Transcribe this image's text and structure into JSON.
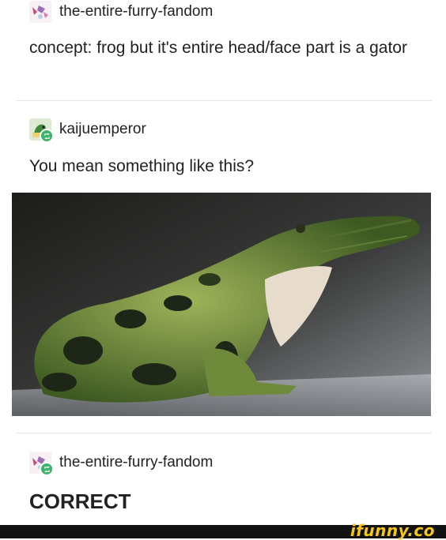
{
  "posts": [
    {
      "username": "the-entire-furry-fandom",
      "text": "concept: frog but it's entire head/face part is a gator"
    },
    {
      "username": "kaijuemperor",
      "text": "You mean something like this?"
    },
    {
      "username": "the-entire-furry-fandom",
      "text": "CORRECT"
    }
  ],
  "image": {
    "description_icon": "frog-gator-photo"
  },
  "watermark": {
    "text": "ifunny.co",
    "color": "#f5c518"
  },
  "colors": {
    "reblog_badge": "#3bb36b",
    "text": "#222222",
    "divider": "#e6e6e6"
  }
}
